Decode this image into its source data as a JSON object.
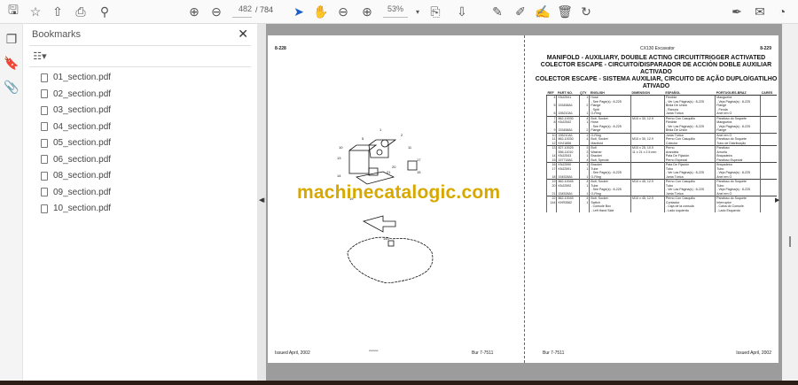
{
  "toolbar": {
    "page_current": "482",
    "page_total": "/ 784",
    "zoom": "53%"
  },
  "panel": {
    "title": "Bookmarks",
    "items": [
      "01_section.pdf",
      "02_section.pdf",
      "03_section.pdf",
      "04_section.pdf",
      "05_section.pdf",
      "06_section.pdf",
      "08_section.pdf",
      "09_section.pdf",
      "10_section.pdf"
    ]
  },
  "left_page": {
    "number": "8-228",
    "footer_left": "Issued April, 2002",
    "footer_right": "Bur 7-7511",
    "fig_code": "xxxxxxx",
    "callouts": [
      "1",
      "2",
      "3",
      "4",
      "5",
      "6",
      "9",
      "10",
      "11",
      "12",
      "13",
      "14",
      "15",
      "16",
      "17",
      "18",
      "19",
      "20",
      "21",
      "144"
    ]
  },
  "right_page": {
    "header_model": "CX130 Excavator",
    "number": "8-229",
    "title": [
      "MANIFOLD - AUXILIARY, DOUBLE ACTING CIRCUIT/TRIGGER ACTIVATED",
      "COLECTOR ESCAPE - CIRCUITO/DISPARADOR DE ACCIÓN DOBLE AUXILIAR ACTIVADO",
      "COLECTOR ESCAPE - SISTEMA AUXILIAR, CIRCUITO DE AÇÃO DUPLO/GATILHO ATIVADO"
    ],
    "columns": [
      "REF",
      "PART NO.",
      "QTY",
      "ENGLISH",
      "DIMENSION",
      "ESPAÑOL",
      "PORTUGUES-BRAZ",
      "CARES"
    ],
    "rows": [
      [
        "4",
        "KNJ2541",
        "1",
        "Hose",
        "",
        "Flexible",
        "Mangueira",
        ""
      ],
      [
        "",
        "",
        "",
        "- See Page(s) : 8-225",
        "",
        "- Ver Las Página(s) : 8-225",
        "- Veja Página(s) : 8-225",
        ""
      ],
      [
        "5",
        "153458A1",
        "2",
        "Flange",
        "",
        "Brida De Unión",
        "Flange",
        ""
      ],
      [
        "",
        "",
        "",
        "- Split",
        "",
        "- Ranura",
        "- Fenda",
        ""
      ],
      [
        "6",
        "155210A1",
        "1",
        "O-Ring",
        "",
        "Junta Tórica",
        "Anel em O",
        ""
      ],
      [
        "7",
        "862-10030",
        "4",
        "Bolt, Socket",
        "M10 x 30, 12.9",
        "Perno Con Casquillo",
        "Parafuso do Soquete",
        ""
      ],
      [
        "8",
        "KNJ2542",
        "1",
        "Hose",
        "",
        "Flexible",
        "Mangueira",
        ""
      ],
      [
        "",
        "",
        "",
        "- See Page(s) : 8-225",
        "",
        "- Ver Las Página(s) : 8-225",
        "- Veja Página(s) : 8-225",
        ""
      ],
      [
        "9",
        "153458A1",
        "2",
        "Flange",
        "",
        "Brida De Unión",
        "Flange",
        ""
      ],
      [
        "10",
        "155210A1",
        "1",
        "O-Ring",
        "",
        "Junta Tórica",
        "Anel em O",
        ""
      ],
      [
        "11",
        "862-10030",
        "4",
        "Bolt, Socket",
        "M10 x 30, 12.9",
        "Perno Con Casquillo",
        "Parafuso do Soquete",
        ""
      ],
      [
        "12",
        "KHJ1856",
        "",
        "Manifold",
        "",
        "Colector",
        "Tubo de Distribuição",
        ""
      ],
      [
        "13",
        "827-10025",
        "3",
        "Bolt",
        "M10 x 25, 10.9",
        "Perno",
        "Parafuso",
        ""
      ],
      [
        "",
        "556-11010",
        "3",
        "Washer",
        "11 x 21 x 2.5 mm",
        "Arandela",
        "Arruela",
        ""
      ],
      [
        "14",
        "KNJ2543",
        "1",
        "Bracket",
        "",
        "Pata De Fijación",
        "Braçadeira",
        ""
      ],
      [
        "15",
        "157718A1",
        "4",
        "Bolt, Special",
        "",
        "Perno Especial",
        "Parafuso Especial",
        ""
      ],
      [
        "16",
        "KNJ2590",
        "1",
        "Bracket",
        "",
        "Pata De Fijación",
        "Braçadeira",
        ""
      ],
      [
        "17",
        "KNJ2591",
        "1",
        "Tube",
        "",
        "Tubo",
        "Tubo",
        ""
      ],
      [
        "",
        "",
        "",
        "- See Page(s) : 8-225",
        "",
        "- Ver Las Página(s) : 8-225",
        "- Veja Página(s) : 8-225",
        ""
      ],
      [
        "18",
        "154528A1",
        "1",
        "O-Ring",
        "",
        "Junta Tórica",
        "Anel em O",
        ""
      ],
      [
        "19",
        "862-10045",
        "4",
        "Bolt, Socket",
        "M10 x 45, 12.9",
        "Perno Con Casquillo",
        "Parafuso do Soquete",
        ""
      ],
      [
        "20",
        "KNJ2592",
        "1",
        "Tube",
        "",
        "Tubo",
        "Tubo",
        ""
      ],
      [
        "",
        "",
        "",
        "- See Page(s) : 8-225",
        "",
        "- Ver Las Página(s) : 8-225",
        "- Veja Página(s) : 8-225",
        ""
      ],
      [
        "21",
        "154528A1",
        "1",
        "O-Ring",
        "",
        "Junta Tórica",
        "Anel em O",
        ""
      ],
      [
        "22",
        "862-10045",
        "4",
        "Bolt, Socket",
        "M10 x 45, 12.9",
        "Perno Con Casquillo",
        "Parafuso do Soquete",
        ""
      ],
      [
        "144",
        "KHR3562",
        "1",
        "Switch",
        "",
        "Contactor",
        "Interruptor",
        ""
      ],
      [
        "",
        "",
        "",
        "- Console Box",
        "",
        "- Caja de la consola",
        "- Caixa do Console",
        ""
      ],
      [
        "",
        "",
        "",
        "- Left Hand Side",
        "",
        "- Lado Izquierdo",
        "- Lado Esquerdo",
        ""
      ]
    ],
    "footer_left": "Bur 7-7511",
    "footer_right": "Issued April, 2002"
  },
  "watermark": "machinecatalogic.com"
}
